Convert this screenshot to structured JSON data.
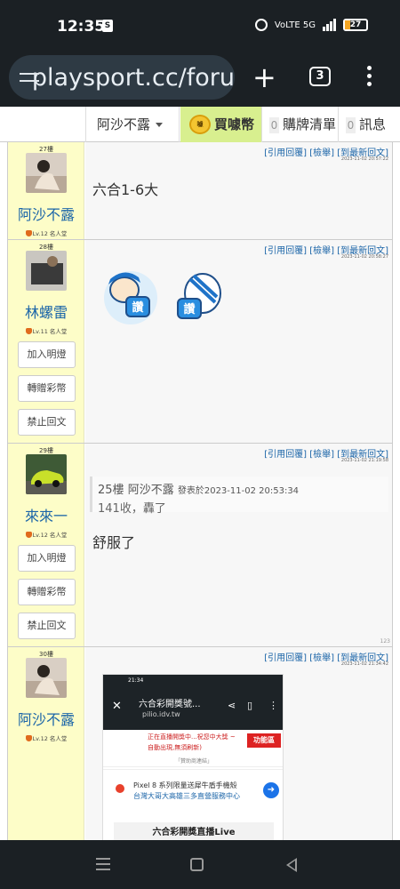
{
  "status": {
    "time": "12:35",
    "bag_icon": "S",
    "network": "VoLTE 5G",
    "battery": "27"
  },
  "browser": {
    "url": "playsport.cc/foru",
    "tab_count": "3"
  },
  "nav": {
    "user_menu": "阿沙不露",
    "buy_coins": "買噱幣",
    "coin_label": "噱",
    "cart_label": "購牌清單",
    "cart_count": "0",
    "msg_label": "訊息",
    "msg_count": "0"
  },
  "post_actions": {
    "quote": "[引用回覆]",
    "report": "[檢舉]",
    "latest": "[到最新回文]"
  },
  "side_buttons": {
    "light": "加入明燈",
    "gift": "轉贈彩幣",
    "ban": "禁止回文"
  },
  "posts": [
    {
      "floor": "27樓",
      "user": "阿沙不露",
      "level": "Lv.12 名人堂",
      "time": "2023-11-02 20:57:22",
      "text": "六合1-6大"
    },
    {
      "floor": "28樓",
      "user": "林螺雷",
      "level": "Lv.11 名人堂",
      "time": "2023-11-02 20:58:27",
      "sticker1": "讚",
      "sticker2": "讚"
    },
    {
      "floor": "29樓",
      "user": "來來一",
      "level": "Lv.12 名人堂",
      "time": "2023-11-02 21:19:58",
      "quote_floor": "25樓",
      "quote_user": "阿沙不露",
      "quote_time": "發表於2023-11-02 20:53:34",
      "quote_text": "141收，轟了",
      "text": "舒服了",
      "num": "123"
    },
    {
      "floor": "30樓",
      "user": "阿沙不露",
      "level": "Lv.12 名人堂",
      "time": "2023-11-02 21:34:42",
      "shot": {
        "time": "21:34",
        "title": "六合彩開獎號...",
        "domain": "pilio.idv.tw",
        "notice1": "正在直播開獎中...祝您中大獎 ~",
        "notice2": "自動出現,無須刷新)",
        "tag": "功能區",
        "sponsor": "「贊助商連結」",
        "ad1": "Pixel 8 系列限量送犀牛盾手機殼",
        "ad2": "台灣大哥大高雄三多直營服務中心",
        "live": "六合彩開獎直播Live"
      }
    }
  ],
  "colors": {
    "side_bg": "#fdfdc8",
    "link": "#1b65a8",
    "buy_bg": "#d8ef8f"
  }
}
